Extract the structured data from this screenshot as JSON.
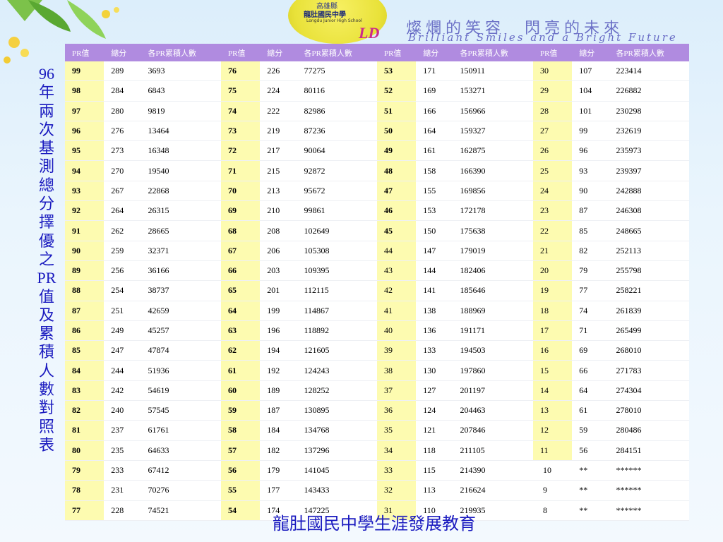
{
  "header": {
    "logo_top": "高雄縣",
    "school_name": "龍肚國民中學",
    "logo_en": "Longdu Junior High School",
    "logo_mark": "LD",
    "slogan_cn": "燦爛的笑容　閃亮的未來",
    "slogan_en": "Brilliant Smiles and a Bright Future"
  },
  "title": "96年兩次基測總分擇優之PR值及累積人數對照表",
  "footer": "龍肚國民中學生涯發展教育",
  "columns": [
    "PR值",
    "總分",
    "各PR累積人數"
  ],
  "groups": [
    [
      [
        "99",
        "289",
        "3693"
      ],
      [
        "98",
        "284",
        "6843"
      ],
      [
        "97",
        "280",
        "9819"
      ],
      [
        "96",
        "276",
        "13464"
      ],
      [
        "95",
        "273",
        "16348"
      ],
      [
        "94",
        "270",
        "19540"
      ],
      [
        "93",
        "267",
        "22868"
      ],
      [
        "92",
        "264",
        "26315"
      ],
      [
        "91",
        "262",
        "28665"
      ],
      [
        "90",
        "259",
        "32371"
      ],
      [
        "89",
        "256",
        "36166"
      ],
      [
        "88",
        "254",
        "38737"
      ],
      [
        "87",
        "251",
        "42659"
      ],
      [
        "86",
        "249",
        "45257"
      ],
      [
        "85",
        "247",
        "47874"
      ],
      [
        "84",
        "244",
        "51936"
      ],
      [
        "83",
        "242",
        "54619"
      ],
      [
        "82",
        "240",
        "57545"
      ],
      [
        "81",
        "237",
        "61761"
      ],
      [
        "80",
        "235",
        "64633"
      ],
      [
        "79",
        "233",
        "67412"
      ],
      [
        "78",
        "231",
        "70276"
      ],
      [
        "77",
        "228",
        "74521"
      ]
    ],
    [
      [
        "76",
        "226",
        "77275"
      ],
      [
        "75",
        "224",
        "80116"
      ],
      [
        "74",
        "222",
        "82986"
      ],
      [
        "73",
        "219",
        "87236"
      ],
      [
        "72",
        "217",
        "90064"
      ],
      [
        "71",
        "215",
        "92872"
      ],
      [
        "70",
        "213",
        "95672"
      ],
      [
        "69",
        "210",
        "99861"
      ],
      [
        "68",
        "208",
        "102649"
      ],
      [
        "67",
        "206",
        "105308"
      ],
      [
        "66",
        "203",
        "109395"
      ],
      [
        "65",
        "201",
        "112115"
      ],
      [
        "64",
        "199",
        "114867"
      ],
      [
        "63",
        "196",
        "118892"
      ],
      [
        "62",
        "194",
        "121605"
      ],
      [
        "61",
        "192",
        "124243"
      ],
      [
        "60",
        "189",
        "128252"
      ],
      [
        "59",
        "187",
        "130895"
      ],
      [
        "58",
        "184",
        "134768"
      ],
      [
        "57",
        "182",
        "137296"
      ],
      [
        "56",
        "179",
        "141045"
      ],
      [
        "55",
        "177",
        "143433"
      ],
      [
        "54",
        "174",
        "147225"
      ]
    ],
    [
      [
        "53",
        "171",
        "150911"
      ],
      [
        "52",
        "169",
        "153271"
      ],
      [
        "51",
        "166",
        "156966"
      ],
      [
        "50",
        "164",
        "159327"
      ],
      [
        "49",
        "161",
        "162875"
      ],
      [
        "48",
        "158",
        "166390"
      ],
      [
        "47",
        "155",
        "169856"
      ],
      [
        "46",
        "153",
        "172178"
      ],
      [
        "45",
        "150",
        "175638"
      ],
      [
        "44",
        "147",
        "179019"
      ],
      [
        "43",
        "144",
        "182406"
      ],
      [
        "42",
        "141",
        "185646"
      ],
      [
        "41",
        "138",
        "188969"
      ],
      [
        "40",
        "136",
        "191171"
      ],
      [
        "39",
        "133",
        "194503"
      ],
      [
        "38",
        "130",
        "197860"
      ],
      [
        "37",
        "127",
        "201197"
      ],
      [
        "36",
        "124",
        "204463"
      ],
      [
        "35",
        "121",
        "207846"
      ],
      [
        "34",
        "118",
        "211105"
      ],
      [
        "33",
        "115",
        "214390"
      ],
      [
        "32",
        "113",
        "216624"
      ],
      [
        "31",
        "110",
        "219935"
      ]
    ],
    [
      [
        "30",
        "107",
        "223414"
      ],
      [
        "29",
        "104",
        "226882"
      ],
      [
        "28",
        "101",
        "230298"
      ],
      [
        "27",
        "99",
        "232619"
      ],
      [
        "26",
        "96",
        "235973"
      ],
      [
        "25",
        "93",
        "239397"
      ],
      [
        "24",
        "90",
        "242888"
      ],
      [
        "23",
        "87",
        "246308"
      ],
      [
        "22",
        "85",
        "248665"
      ],
      [
        "21",
        "82",
        "252113"
      ],
      [
        "20",
        "79",
        "255798"
      ],
      [
        "19",
        "77",
        "258221"
      ],
      [
        "18",
        "74",
        "261839"
      ],
      [
        "17",
        "71",
        "265499"
      ],
      [
        "16",
        "69",
        "268010"
      ],
      [
        "15",
        "66",
        "271783"
      ],
      [
        "14",
        "64",
        "274304"
      ],
      [
        "13",
        "61",
        "278010"
      ],
      [
        "12",
        "59",
        "280486"
      ],
      [
        "11",
        "56",
        "284151"
      ],
      [
        "10",
        "**",
        "******"
      ],
      [
        "9",
        "**",
        "******"
      ],
      [
        "8",
        "**",
        "******"
      ]
    ]
  ],
  "colors": {
    "header_bg": "#b08be0",
    "pr_highlight": "#fdfbb0",
    "title_blue": "#1a1abf"
  }
}
